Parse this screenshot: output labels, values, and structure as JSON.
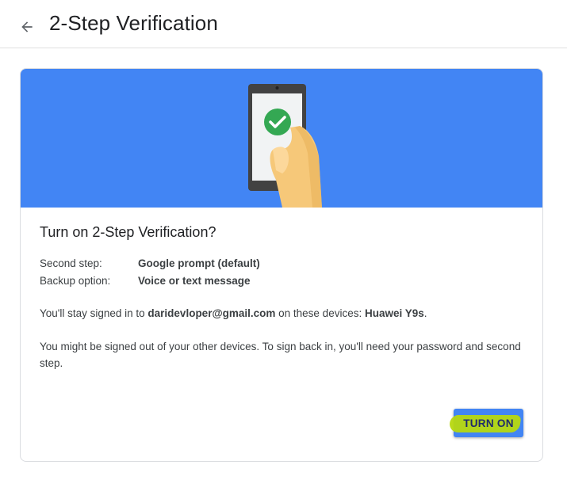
{
  "header": {
    "title": "2-Step Verification",
    "back_icon": "arrow-back-icon"
  },
  "card": {
    "title": "Turn on 2-Step Verification?",
    "second_step_label": "Second step:",
    "second_step_value": "Google prompt (default)",
    "backup_label": "Backup option:",
    "backup_value": "Voice or text message",
    "signed_in_prefix": "You'll stay signed in to ",
    "email": "daridevloper@gmail.com",
    "signed_in_middle": " on these devices: ",
    "device": "Huawei Y9s",
    "signed_in_suffix": ".",
    "signout_note": "You might be signed out of your other devices. To sign back in, you'll need your password and second step.",
    "turn_on_label": "TURN ON"
  },
  "colors": {
    "accent": "#4285f4",
    "highlight": "#b7d80f",
    "check": "#34a853"
  }
}
